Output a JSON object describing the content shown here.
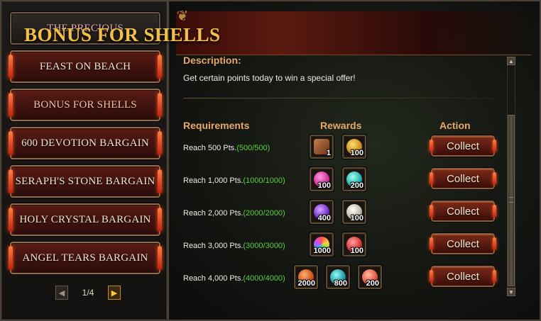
{
  "sidebar": {
    "items": [
      {
        "label": "THE PRECIOUS"
      },
      {
        "label": "FEAST ON BEACH"
      },
      {
        "label": "BONUS FOR SHELLS"
      },
      {
        "label": "600 DEVOTION BARGAIN"
      },
      {
        "label": "SERAPH'S STONE BARGAIN"
      },
      {
        "label": "HOLY CRYSTAL BARGAIN"
      },
      {
        "label": "ANGEL TEARS BARGAIN"
      }
    ],
    "pager": {
      "label": "1/4",
      "prev_icon": "left-arrow-icon",
      "next_icon": "right-arrow-icon"
    }
  },
  "main": {
    "title": "BONUS FOR SHELLS",
    "description_heading": "Description:",
    "description_text": "Get certain points today to win a special offer!",
    "columns": {
      "requirements": "Requirements",
      "rewards": "Rewards",
      "action": "Action"
    },
    "rows": [
      {
        "label": "Reach 500 Pts.",
        "progress": "(500/500)",
        "action": "Collect",
        "rewards": [
          {
            "icon": "scroll-item-icon",
            "qty": "1"
          },
          {
            "icon": "gold-crown-icon",
            "qty": "100"
          }
        ]
      },
      {
        "label": "Reach 1,000 Pts.",
        "progress": "(1000/1000)",
        "action": "Collect",
        "rewards": [
          {
            "icon": "pink-star-gem-icon",
            "qty": "100"
          },
          {
            "icon": "cyan-gem-icon",
            "qty": "200"
          }
        ]
      },
      {
        "label": "Reach 2,000 Pts.",
        "progress": "(2000/2000)",
        "action": "Collect",
        "rewards": [
          {
            "icon": "purple-orb-icon",
            "qty": "400"
          },
          {
            "icon": "white-gem-icon",
            "qty": "100"
          }
        ]
      },
      {
        "label": "Reach 3,000 Pts.",
        "progress": "(3000/3000)",
        "action": "Collect",
        "rewards": [
          {
            "icon": "rainbow-gem-icon",
            "qty": "1000"
          },
          {
            "icon": "red-crystal-icon",
            "qty": "100"
          }
        ]
      },
      {
        "label": "Reach 4,000 Pts.",
        "progress": "(4000/4000)",
        "action": "Collect",
        "rewards": [
          {
            "icon": "orange-orb-icon",
            "qty": "2000"
          },
          {
            "icon": "teal-gem-icon",
            "qty": "800"
          },
          {
            "icon": "peach-crystal-icon",
            "qty": "200"
          }
        ]
      }
    ]
  },
  "colors": {
    "accent_gold": "#f2c04a",
    "heading_orange": "#e8a868",
    "progress_green": "#5ad040",
    "button_red": "#7a2a18"
  }
}
